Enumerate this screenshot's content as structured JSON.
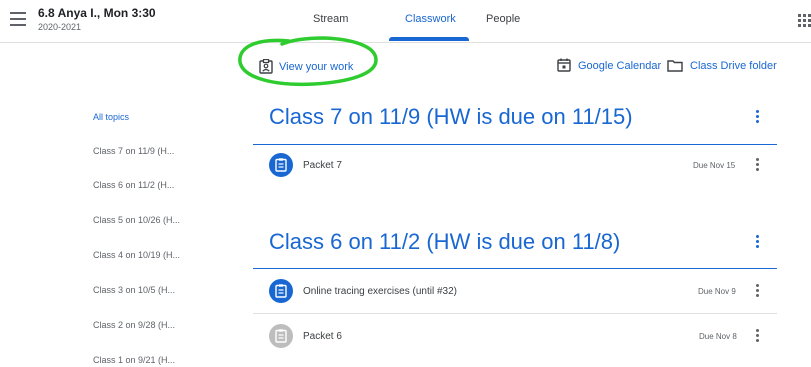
{
  "header": {
    "class_name": "6.8 Anya I., Mon 3:30",
    "class_year": "2020-2021",
    "tabs": [
      {
        "label": "Stream",
        "active": false
      },
      {
        "label": "Classwork",
        "active": true
      },
      {
        "label": "People",
        "active": false
      }
    ],
    "menu_icon": "hamburger-menu-icon",
    "apps_icon": "apps-grid-icon"
  },
  "toolbar": {
    "view_your_work": "View your work",
    "google_calendar": "Google Calendar",
    "class_drive_folder": "Class Drive folder"
  },
  "sidebar": {
    "items": [
      {
        "label": "All topics",
        "active": true
      },
      {
        "label": "Class 7 on 11/9 (H...",
        "active": false
      },
      {
        "label": "Class 6 on 11/2 (H...",
        "active": false
      },
      {
        "label": "Class 5 on 10/26 (H...",
        "active": false
      },
      {
        "label": "Class 4 on 10/19 (H...",
        "active": false
      },
      {
        "label": "Class 3 on 10/5 (H...",
        "active": false
      },
      {
        "label": "Class 2 on 9/28 (H...",
        "active": false
      },
      {
        "label": "Class 1 on 9/21 (H...",
        "active": false
      }
    ]
  },
  "topics": [
    {
      "title": "Class 7 on 11/9 (HW is due on 11/15)",
      "assignments": [
        {
          "title": "Packet 7",
          "due": "Due Nov 15",
          "icon_color": "#1967d2"
        }
      ]
    },
    {
      "title": "Class 6 on 11/2 (HW is due on 11/8)",
      "assignments": [
        {
          "title": "Online tracing exercises (until #32)",
          "due": "Due Nov 9",
          "icon_color": "#1967d2"
        },
        {
          "title": "Packet 6",
          "due": "Due Nov 8",
          "icon_color": "#bdbdbd"
        }
      ]
    }
  ],
  "colors": {
    "accent": "#1967d2",
    "annotation": "#2ecc2e"
  }
}
